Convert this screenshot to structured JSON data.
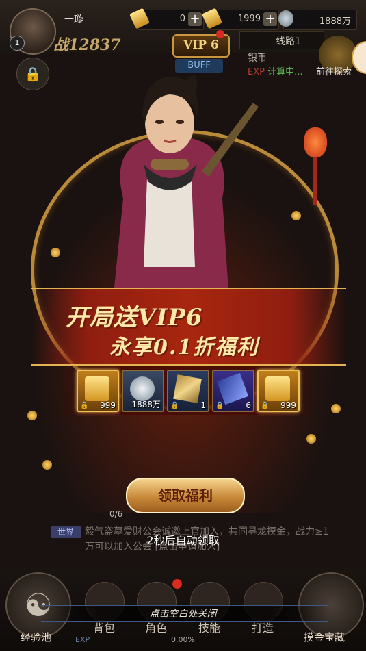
{
  "player": {
    "name": "一璇",
    "level": "1",
    "power": "战12837"
  },
  "resources": [
    {
      "icon": "gold-bar-icon",
      "value": "0"
    },
    {
      "icon": "gold-bar-icon",
      "value": "1999"
    },
    {
      "icon": "silver-coin-icon",
      "value": "1888万"
    }
  ],
  "vip_badge": "VIP 6",
  "buff_label": "BUFF",
  "server_line": "线路1",
  "silver_label": "银币",
  "exp_label": "EXP",
  "exp_status": "计算中...",
  "explore_label": "前往探索",
  "popup": {
    "headline_line1": "开局送VIP6",
    "headline_line2": "永享0.1折福利",
    "rewards": [
      {
        "type": "gold-chest",
        "count": "999"
      },
      {
        "type": "silver-coin",
        "count": "1888万"
      },
      {
        "type": "card",
        "count": "1"
      },
      {
        "type": "ticket",
        "count": "6"
      },
      {
        "type": "gold-chest",
        "count": "999"
      }
    ],
    "claim_button": "领取福利",
    "auto_claim_countdown": "2秒后自动领取"
  },
  "progress": "0/6",
  "chat": {
    "channel": "世界",
    "message": "毅气盗墓爱财公会诚邀上官加入，共同寻龙摸金，战力≥1万可以加入公会 [点击申请加入]"
  },
  "dock": {
    "left_circle": "经验池",
    "tabs": [
      "背包",
      "角色",
      "技能",
      "打造"
    ],
    "right_circle": "摸金宝藏",
    "close_hint": "点击空白处关闭",
    "exp_text": "EXP",
    "exp_percent": "0.00%"
  },
  "colors": {
    "gold": "#f0c35a",
    "banner_red": "#a8260f",
    "headline": "#ffe9a8"
  }
}
